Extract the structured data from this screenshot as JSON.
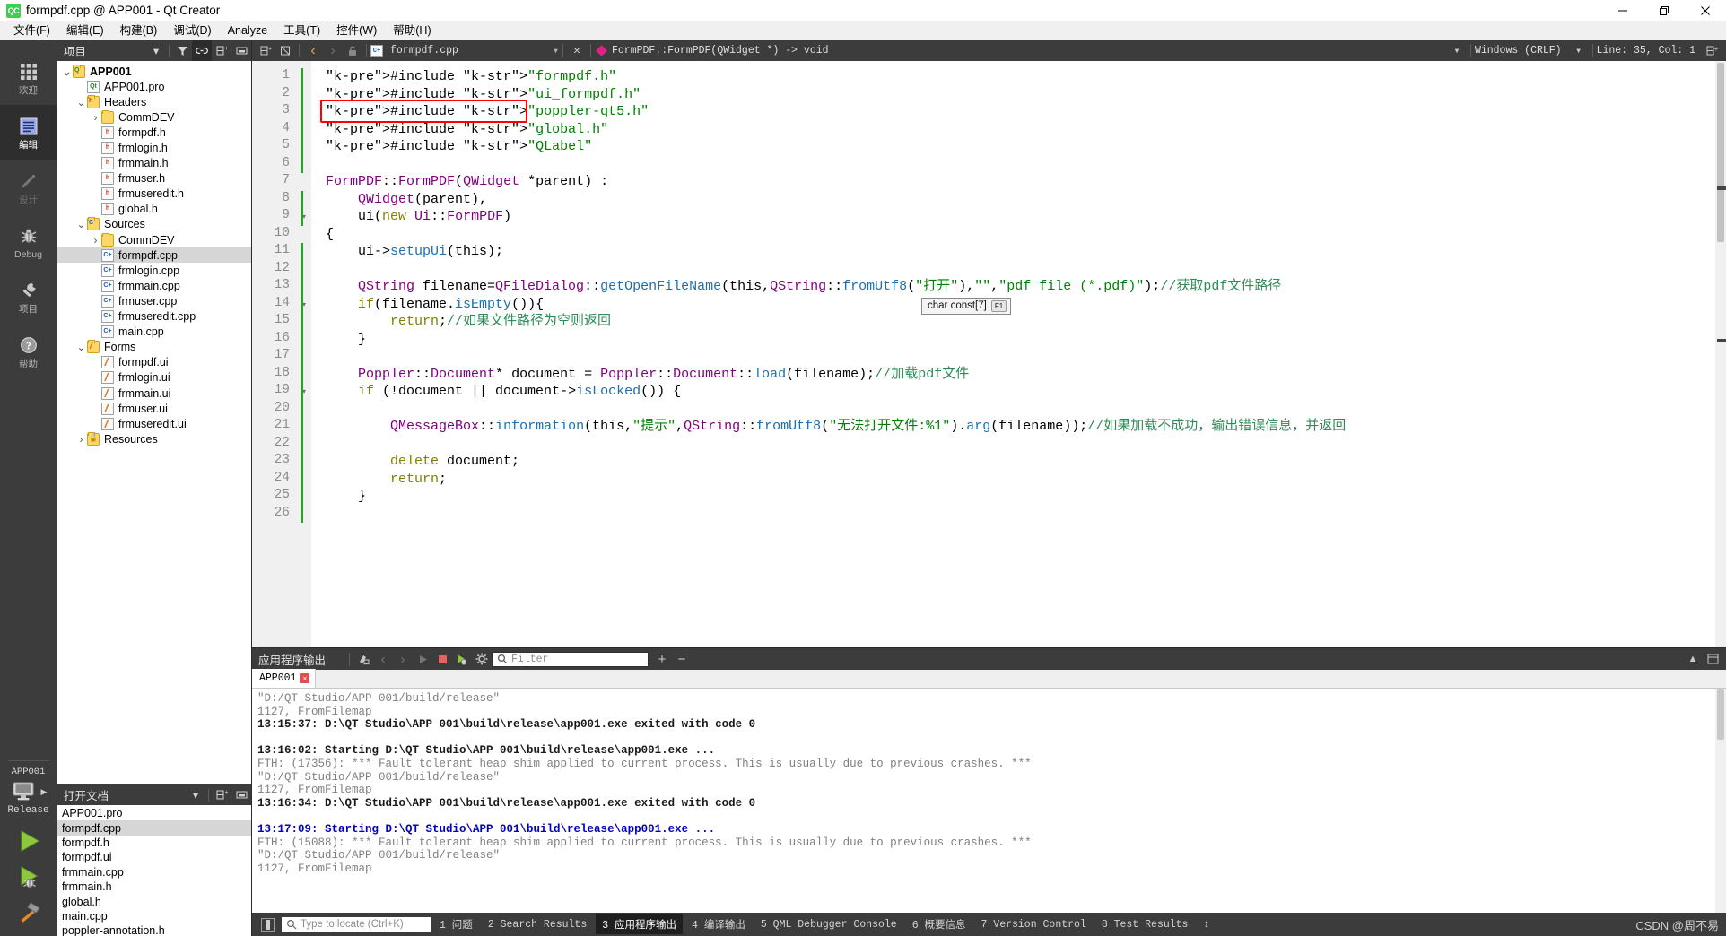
{
  "window": {
    "title": "formpdf.cpp @ APP001 - Qt Creator",
    "app_badge": "QC",
    "minimize": "—",
    "maximize": "❐",
    "close": "✕"
  },
  "menubar": [
    {
      "label": "文件(F)",
      "accel": "F"
    },
    {
      "label": "编辑(E)",
      "accel": "E"
    },
    {
      "label": "构建(B)",
      "accel": "B"
    },
    {
      "label": "调试(D)",
      "accel": "D"
    },
    {
      "label": "Analyze",
      "accel": "A"
    },
    {
      "label": "工具(T)",
      "accel": "T"
    },
    {
      "label": "控件(W)",
      "accel": "W"
    },
    {
      "label": "帮助(H)",
      "accel": "H"
    }
  ],
  "modebar": {
    "items": [
      {
        "label": "欢迎",
        "icon": "grid-icon",
        "state": "normal"
      },
      {
        "label": "编辑",
        "icon": "edit-lines-icon",
        "state": "active"
      },
      {
        "label": "设计",
        "icon": "pencil-icon",
        "state": "disabled"
      },
      {
        "label": "Debug",
        "icon": "bug-icon",
        "state": "normal"
      },
      {
        "label": "项目",
        "icon": "wrench-icon",
        "state": "normal"
      },
      {
        "label": "帮助",
        "icon": "question-mark-icon",
        "state": "normal"
      }
    ],
    "kit_name": "APP001",
    "build_config": "Release",
    "run_button": "run-icon",
    "debug_button": "run-debug-icon",
    "build_button": "hammer-icon"
  },
  "project_panel": {
    "title": "项目",
    "icons": [
      "chevron-down-icon",
      "filter-icon",
      "link-icon",
      "split-icon",
      "minimize-panel-icon"
    ],
    "tree": [
      {
        "label": "APP001",
        "depth": 0,
        "arrow": "⌄",
        "icon": "qt-project-icon",
        "bold": true,
        "selected": false
      },
      {
        "label": "APP001.pro",
        "depth": 1,
        "arrow": "",
        "icon": "qt-pro-file-icon",
        "bold": false,
        "selected": false
      },
      {
        "label": "Headers",
        "depth": 1,
        "arrow": "⌄",
        "icon": "headers-folder-icon",
        "bold": false,
        "selected": false
      },
      {
        "label": "CommDEV",
        "depth": 2,
        "arrow": "›",
        "icon": "folder-icon",
        "bold": false,
        "selected": false
      },
      {
        "label": "formpdf.h",
        "depth": 2,
        "arrow": "",
        "icon": "h-file-icon",
        "bold": false,
        "selected": false
      },
      {
        "label": "frmlogin.h",
        "depth": 2,
        "arrow": "",
        "icon": "h-file-icon",
        "bold": false,
        "selected": false
      },
      {
        "label": "frmmain.h",
        "depth": 2,
        "arrow": "",
        "icon": "h-file-icon",
        "bold": false,
        "selected": false
      },
      {
        "label": "frmuser.h",
        "depth": 2,
        "arrow": "",
        "icon": "h-file-icon",
        "bold": false,
        "selected": false
      },
      {
        "label": "frmuseredit.h",
        "depth": 2,
        "arrow": "",
        "icon": "h-file-icon",
        "bold": false,
        "selected": false
      },
      {
        "label": "global.h",
        "depth": 2,
        "arrow": "",
        "icon": "h-file-icon",
        "bold": false,
        "selected": false
      },
      {
        "label": "Sources",
        "depth": 1,
        "arrow": "⌄",
        "icon": "sources-folder-icon",
        "bold": false,
        "selected": false
      },
      {
        "label": "CommDEV",
        "depth": 2,
        "arrow": "›",
        "icon": "folder-icon",
        "bold": false,
        "selected": false
      },
      {
        "label": "formpdf.cpp",
        "depth": 2,
        "arrow": "",
        "icon": "cpp-file-icon",
        "bold": false,
        "selected": true
      },
      {
        "label": "frmlogin.cpp",
        "depth": 2,
        "arrow": "",
        "icon": "cpp-file-icon",
        "bold": false,
        "selected": false
      },
      {
        "label": "frmmain.cpp",
        "depth": 2,
        "arrow": "",
        "icon": "cpp-file-icon",
        "bold": false,
        "selected": false
      },
      {
        "label": "frmuser.cpp",
        "depth": 2,
        "arrow": "",
        "icon": "cpp-file-icon",
        "bold": false,
        "selected": false
      },
      {
        "label": "frmuseredit.cpp",
        "depth": 2,
        "arrow": "",
        "icon": "cpp-file-icon",
        "bold": false,
        "selected": false
      },
      {
        "label": "main.cpp",
        "depth": 2,
        "arrow": "",
        "icon": "cpp-file-icon",
        "bold": false,
        "selected": false
      },
      {
        "label": "Forms",
        "depth": 1,
        "arrow": "⌄",
        "icon": "forms-folder-icon",
        "bold": false,
        "selected": false
      },
      {
        "label": "formpdf.ui",
        "depth": 2,
        "arrow": "",
        "icon": "ui-file-icon",
        "bold": false,
        "selected": false
      },
      {
        "label": "frmlogin.ui",
        "depth": 2,
        "arrow": "",
        "icon": "ui-file-icon",
        "bold": false,
        "selected": false
      },
      {
        "label": "frmmain.ui",
        "depth": 2,
        "arrow": "",
        "icon": "ui-file-icon",
        "bold": false,
        "selected": false
      },
      {
        "label": "frmuser.ui",
        "depth": 2,
        "arrow": "",
        "icon": "ui-file-icon",
        "bold": false,
        "selected": false
      },
      {
        "label": "frmuseredit.ui",
        "depth": 2,
        "arrow": "",
        "icon": "ui-file-icon",
        "bold": false,
        "selected": false
      },
      {
        "label": "Resources",
        "depth": 1,
        "arrow": "›",
        "icon": "resources-folder-icon",
        "bold": false,
        "selected": false
      }
    ]
  },
  "open_documents": {
    "title": "打开文档",
    "items": [
      {
        "label": "APP001.pro",
        "selected": false
      },
      {
        "label": "formpdf.cpp",
        "selected": true
      },
      {
        "label": "formpdf.h",
        "selected": false
      },
      {
        "label": "formpdf.ui",
        "selected": false
      },
      {
        "label": "frmmain.cpp",
        "selected": false
      },
      {
        "label": "frmmain.h",
        "selected": false
      },
      {
        "label": "global.h",
        "selected": false
      },
      {
        "label": "main.cpp",
        "selected": false
      },
      {
        "label": "poppler-annotation.h",
        "selected": false
      }
    ]
  },
  "editor_toolbar": {
    "back": "‹",
    "forward": "›",
    "lock_icon": "unlock-icon",
    "file_icon": "cpp-file-icon",
    "filename": "formpdf.cpp",
    "dropdown": "▾",
    "close": "✕",
    "symbol": "FormPDF::FormPDF(QWidget *) -> void",
    "line_ending": "Windows (CRLF)",
    "cursor_position": "Line: 35, Col: 1",
    "split_icon": "split-editor-icon"
  },
  "code": {
    "lines": [
      {
        "n": 1,
        "fold": false,
        "changed": true
      },
      {
        "n": 2,
        "fold": false,
        "changed": true
      },
      {
        "n": 3,
        "fold": false,
        "changed": true
      },
      {
        "n": 4,
        "fold": false,
        "changed": true
      },
      {
        "n": 5,
        "fold": false,
        "changed": true
      },
      {
        "n": 6,
        "fold": false,
        "changed": true
      },
      {
        "n": 7,
        "fold": false,
        "changed": false
      },
      {
        "n": 8,
        "fold": false,
        "changed": true
      },
      {
        "n": 9,
        "fold": true,
        "changed": true
      },
      {
        "n": 10,
        "fold": false,
        "changed": false
      },
      {
        "n": 11,
        "fold": false,
        "changed": true
      },
      {
        "n": 12,
        "fold": false,
        "changed": true
      },
      {
        "n": 13,
        "fold": false,
        "changed": true
      },
      {
        "n": 14,
        "fold": true,
        "changed": true
      },
      {
        "n": 15,
        "fold": false,
        "changed": true
      },
      {
        "n": 16,
        "fold": false,
        "changed": true
      },
      {
        "n": 17,
        "fold": false,
        "changed": true
      },
      {
        "n": 18,
        "fold": false,
        "changed": true
      },
      {
        "n": 19,
        "fold": true,
        "changed": true
      },
      {
        "n": 20,
        "fold": false,
        "changed": true
      },
      {
        "n": 21,
        "fold": false,
        "changed": true
      },
      {
        "n": 22,
        "fold": false,
        "changed": true
      },
      {
        "n": 23,
        "fold": false,
        "changed": true
      },
      {
        "n": 24,
        "fold": false,
        "changed": true
      },
      {
        "n": 25,
        "fold": false,
        "changed": true
      },
      {
        "n": 26,
        "fold": false,
        "changed": true
      }
    ],
    "text": [
      "#include \"formpdf.h\"",
      "#include \"ui_formpdf.h\"",
      "#include \"poppler-qt5.h\"",
      "#include \"global.h\"",
      "#include \"QLabel\"",
      "",
      "FormPDF::FormPDF(QWidget *parent) :",
      "    QWidget(parent),",
      "    ui(new Ui::FormPDF)",
      "{",
      "    ui->setupUi(this);",
      "",
      "    QString filename=QFileDialog::getOpenFileName(this,QString::fromUtf8(\"打开\"),\"\",\"pdf file (*.pdf)\");//获取pdf文件路径",
      "    if(filename.isEmpty()){",
      "        return;//如果文件路径为空则返回",
      "    }",
      "",
      "    Poppler::Document* document = Poppler::Document::load(filename);//加载pdf文件",
      "    if (!document || document->isLocked()) {",
      "",
      "        QMessageBox::information(this,\"提示\",QString::fromUtf8(\"无法打开文件:%1\").arg(filename));//如果加载不成功，输出错误信息，并返回",
      "",
      "        delete document;",
      "        return;",
      "    }",
      ""
    ],
    "highlight_box_line": 3,
    "highlight_box_color": "#ff0000",
    "tooltip": {
      "text": "char const[7]",
      "key": "F1"
    }
  },
  "output_pane": {
    "title": "应用程序输出",
    "filter_placeholder": "Filter",
    "icons": [
      "clean-icon",
      "prev-icon",
      "next-icon",
      "play-icon",
      "stop-icon",
      "run-debug-icon",
      "gear-icon",
      "add-icon",
      "remove-icon"
    ],
    "collapse_icon": "chevron-up-icon",
    "maximize_icon": "maximize-icon",
    "tab": {
      "label": "APP001",
      "close": "✕"
    },
    "lines": [
      {
        "text": "\"D:/QT Studio/APP 001/build/release\"",
        "style": "gray"
      },
      {
        "text": "1127, FromFilemap",
        "style": "gray"
      },
      {
        "text": "13:15:37: D:\\QT Studio\\APP 001\\build\\release\\app001.exe exited with code 0",
        "style": "dark"
      },
      {
        "text": "",
        "style": "gray"
      },
      {
        "text": "13:16:02: Starting D:\\QT Studio\\APP 001\\build\\release\\app001.exe ...",
        "style": "dark"
      },
      {
        "text": "FTH: (17356): *** Fault tolerant heap shim applied to current process. This is usually due to previous crashes. ***",
        "style": "gray"
      },
      {
        "text": "\"D:/QT Studio/APP 001/build/release\"",
        "style": "gray"
      },
      {
        "text": "1127, FromFilemap",
        "style": "gray"
      },
      {
        "text": "13:16:34: D:\\QT Studio\\APP 001\\build\\release\\app001.exe exited with code 0",
        "style": "dark"
      },
      {
        "text": "",
        "style": "gray"
      },
      {
        "text": "13:17:09: Starting D:\\QT Studio\\APP 001\\build\\release\\app001.exe ...",
        "style": "blue"
      },
      {
        "text": "FTH: (15088): *** Fault tolerant heap shim applied to current process. This is usually due to previous crashes. ***",
        "style": "gray"
      },
      {
        "text": "\"D:/QT Studio/APP 001/build/release\"",
        "style": "gray"
      },
      {
        "text": "1127, FromFilemap",
        "style": "gray"
      }
    ]
  },
  "statusbar": {
    "locator_placeholder": "Type to locate (Ctrl+K)",
    "items": [
      {
        "num": "1",
        "label": "问题",
        "active": false
      },
      {
        "num": "2",
        "label": "Search Results",
        "active": false
      },
      {
        "num": "3",
        "label": "应用程序输出",
        "active": true
      },
      {
        "num": "4",
        "label": "编译输出",
        "active": false
      },
      {
        "num": "5",
        "label": "QML Debugger Console",
        "active": false
      },
      {
        "num": "6",
        "label": "概要信息",
        "active": false
      },
      {
        "num": "7",
        "label": "Version Control",
        "active": false
      },
      {
        "num": "8",
        "label": "Test Results",
        "active": false
      }
    ],
    "updown": "↕",
    "watermark": "CSDN @周不易"
  },
  "colors": {
    "chrome_dark": "#3c3c3c",
    "accent_green": "#41cd52",
    "highlight_red": "#ff0000",
    "string_green": "#008000",
    "comment_green": "#2e8b57",
    "type_purple": "#800080",
    "function_blue": "#1a6fb0",
    "keyword_olive": "#808000"
  }
}
